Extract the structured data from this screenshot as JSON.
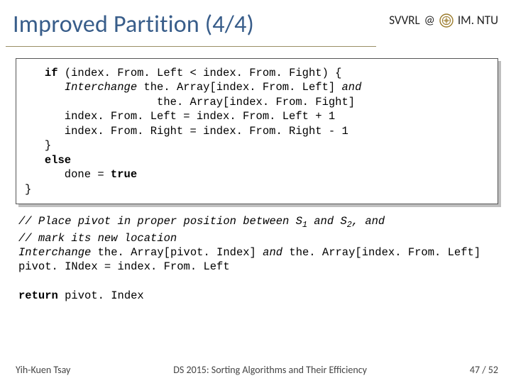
{
  "header": {
    "title": "Improved Partition (4/4)",
    "affiliation_left": "SVVRL",
    "affiliation_at": "@",
    "affiliation_right": "IM. NTU",
    "seal_icon": "ntu-seal-icon"
  },
  "code": {
    "l1_kw": "if",
    "l1_rest": " (index. From. Left < index. From. Fight) {",
    "l2_it": "Interchange",
    "l2_rest": " the. Array[index. From. Left] ",
    "l2_it2": "and",
    "l3_rest": "              the. Array[index. From. Fight]",
    "l4": "   index. From. Left = index. From. Left + 1",
    "l5": "   index. From. Right = index. From. Right - 1",
    "l6": "}",
    "l7_kw": "else",
    "l8a": "   done = ",
    "l8_kw": "true",
    "l9": "}"
  },
  "after": {
    "c1_it": "// Place pivot in proper position between S",
    "c1_sub1": "1",
    "c1_mid": " and S",
    "c1_sub2": "2",
    "c1_end": ", and",
    "c2_it": "// mark its new location",
    "l3_it": "Interchange ",
    "l3_rest": "the. Array[pivot. Index] ",
    "l3_it2": "and ",
    "l3_rest2": "the. Array[index. From. Left]",
    "l4": "pivot. INdex = index. From. Left",
    "ret_kw": "return",
    "ret_rest": " pivot. Index"
  },
  "footer": {
    "left": "Yih-Kuen Tsay",
    "center": "DS 2015: Sorting Algorithms and Their Efficiency",
    "right": "47 / 52"
  }
}
